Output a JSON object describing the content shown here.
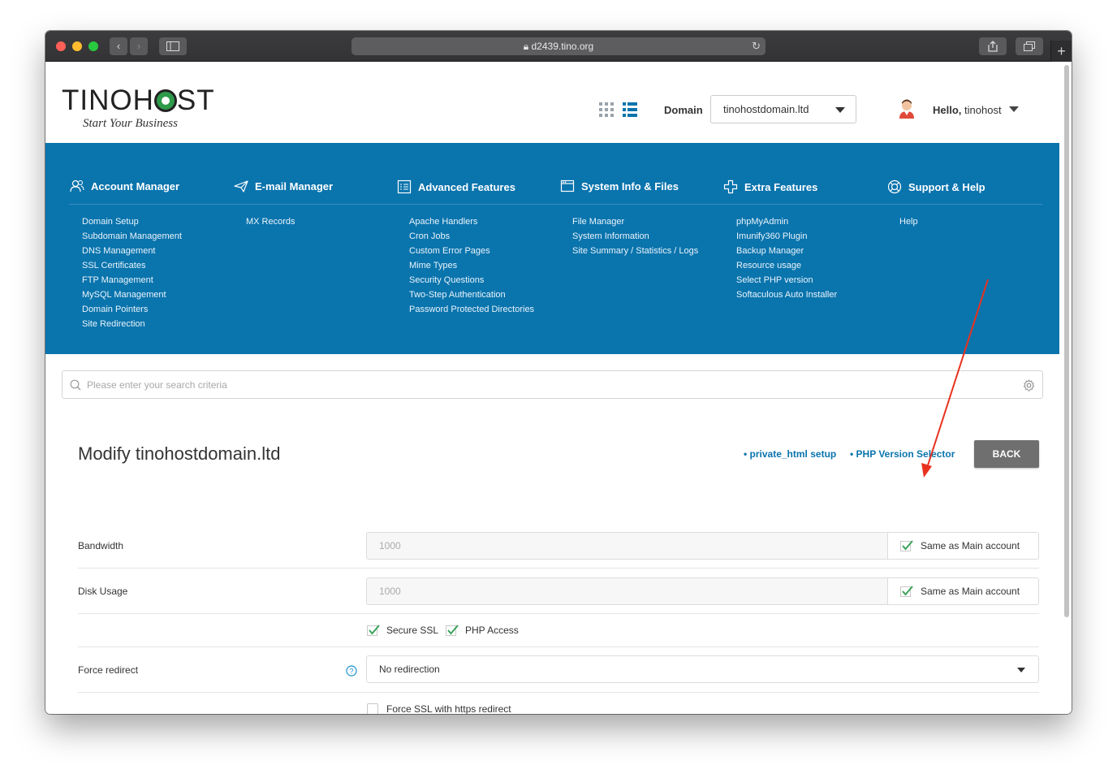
{
  "browser": {
    "url": "d2439.tino.org"
  },
  "header": {
    "logo_text_left": "TINO",
    "logo_text_h": "H",
    "logo_text_right": "ST",
    "logo_tagline": "Start Your Business",
    "domain_label": "Domain",
    "domain_value": "tinohostdomain.ltd",
    "hello_label": "Hello,",
    "username": "tinohost"
  },
  "nav": {
    "columns": [
      {
        "title": "Account Manager",
        "icon": "users-icon",
        "items": [
          "Domain Setup",
          "Subdomain Management",
          "DNS Management",
          "SSL Certificates",
          "FTP Management",
          "MySQL Management",
          "Domain Pointers",
          "Site Redirection"
        ]
      },
      {
        "title": "E-mail Manager",
        "icon": "paper-plane-icon",
        "items": [
          "MX Records"
        ]
      },
      {
        "title": "Advanced Features",
        "icon": "list-document-icon",
        "items": [
          "Apache Handlers",
          "Cron Jobs",
          "Custom Error Pages",
          "Mime Types",
          "Security Questions",
          "Two-Step Authentication",
          "Password Protected Directories"
        ]
      },
      {
        "title": "System Info & Files",
        "icon": "server-icon",
        "items": [
          "File Manager",
          "System Information",
          "Site Summary / Statistics / Logs"
        ]
      },
      {
        "title": "Extra Features",
        "icon": "plus-icon",
        "items": [
          "phpMyAdmin",
          "Imunify360 Plugin",
          "Backup Manager",
          "Resource usage",
          "Select PHP version",
          "Softaculous Auto Installer"
        ]
      },
      {
        "title": "Support & Help",
        "icon": "lifebuoy-icon",
        "items": [
          "Help"
        ]
      }
    ]
  },
  "search": {
    "placeholder": "Please enter your search criteria"
  },
  "main": {
    "title": "Modify tinohostdomain.ltd",
    "links": [
      "• private_html setup",
      "• PHP Version Selector"
    ],
    "back_label": "BACK",
    "bandwidth_label": "Bandwidth",
    "bandwidth_value": "1000",
    "disk_label": "Disk Usage",
    "disk_value": "1000",
    "same_as_main": "Same as Main account",
    "secure_ssl": "Secure SSL",
    "php_access": "PHP Access",
    "force_redirect_label": "Force redirect",
    "force_redirect_value": "No redirection",
    "force_ssl": "Force SSL with https redirect"
  },
  "colors": {
    "nav_blue": "#0a74ad",
    "link_blue": "#0a74ad",
    "check_green": "#3aa35a",
    "annotation_red": "#e8321f"
  }
}
